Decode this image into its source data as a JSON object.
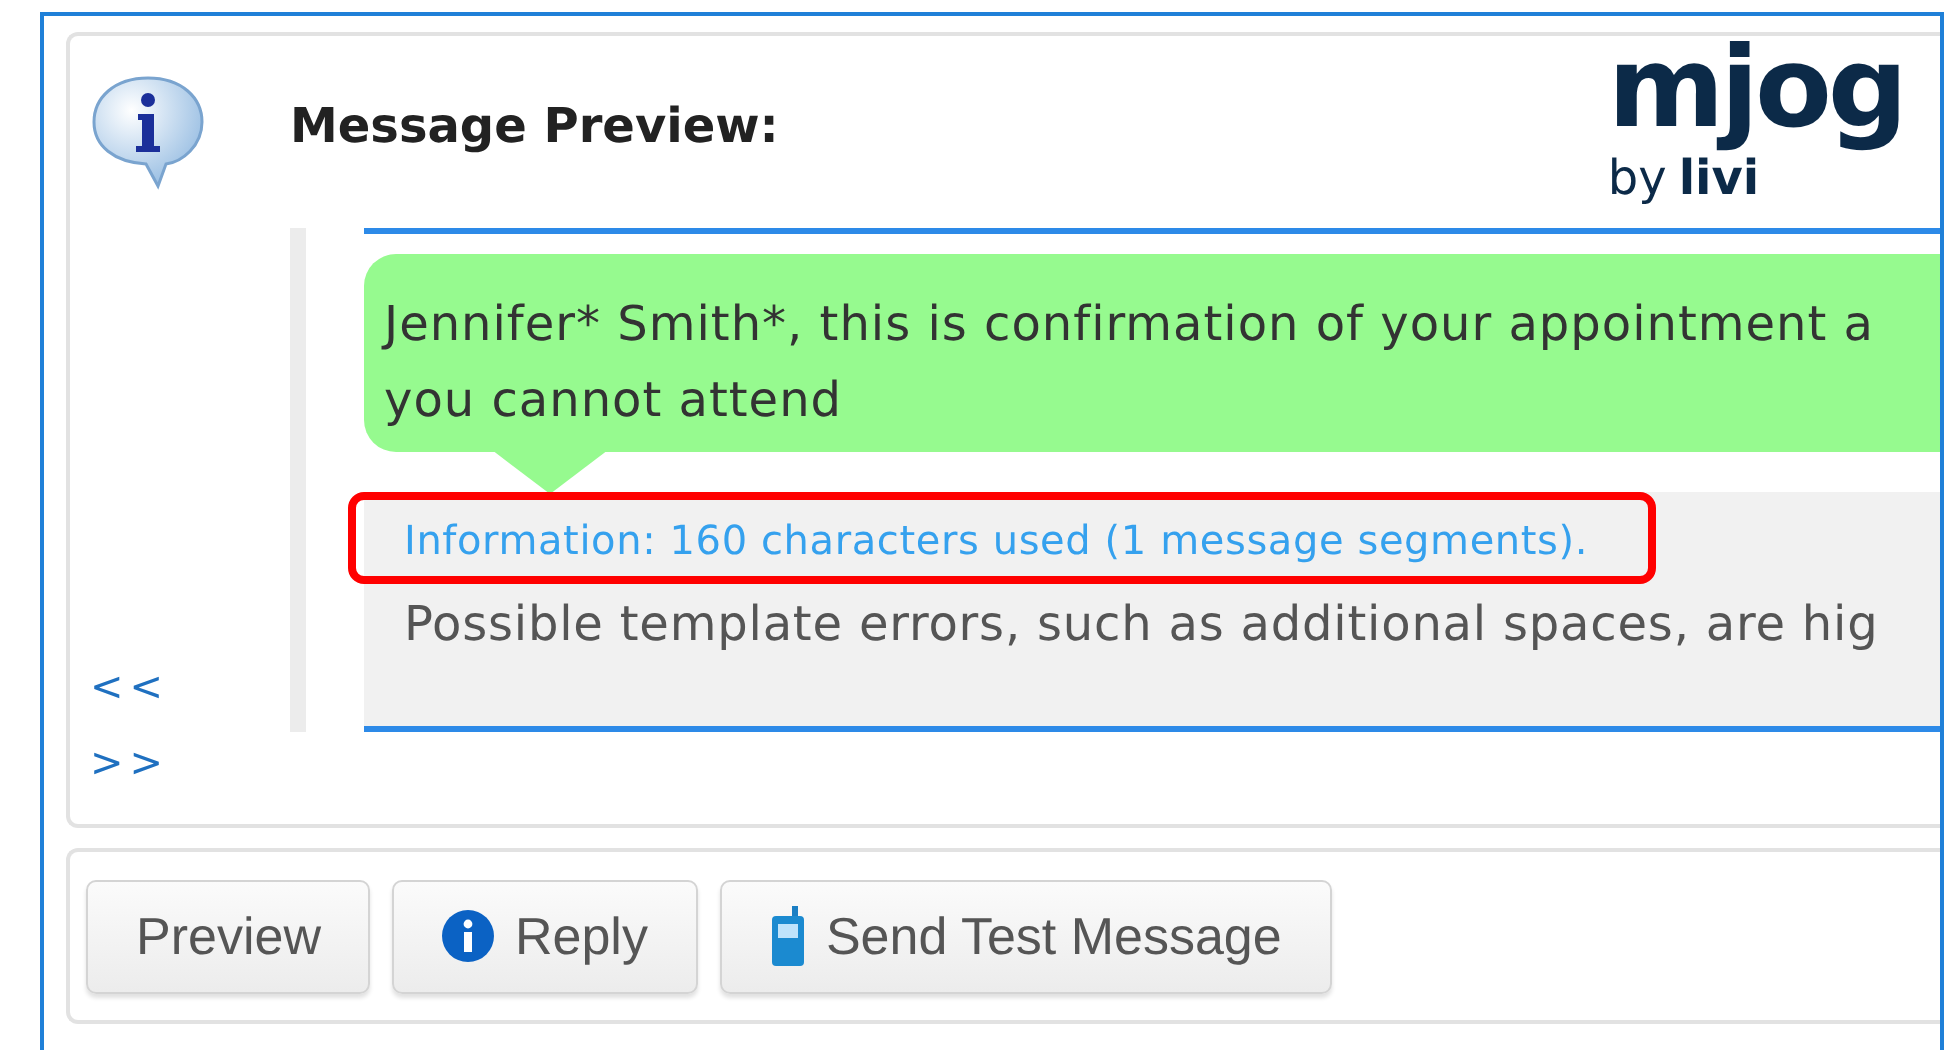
{
  "logo": {
    "name": "mjog",
    "by": "by",
    "brand": "livi"
  },
  "preview": {
    "title": "Message Preview:",
    "message": "Jennifer* Smith*, this is confirmation of your appointment a\nyou cannot attend",
    "information": "Information: 160 characters used (1 message segments).",
    "information_highlighted": true,
    "warning": "Possible template errors, such as additional spaces, are hig",
    "nav": [
      "<<",
      ">>"
    ]
  },
  "buttons": [
    {
      "label": "Preview",
      "kind": "plain"
    },
    {
      "label": "Reply",
      "kind": "reply"
    },
    {
      "label": "Send Test Message",
      "kind": "test"
    }
  ]
}
